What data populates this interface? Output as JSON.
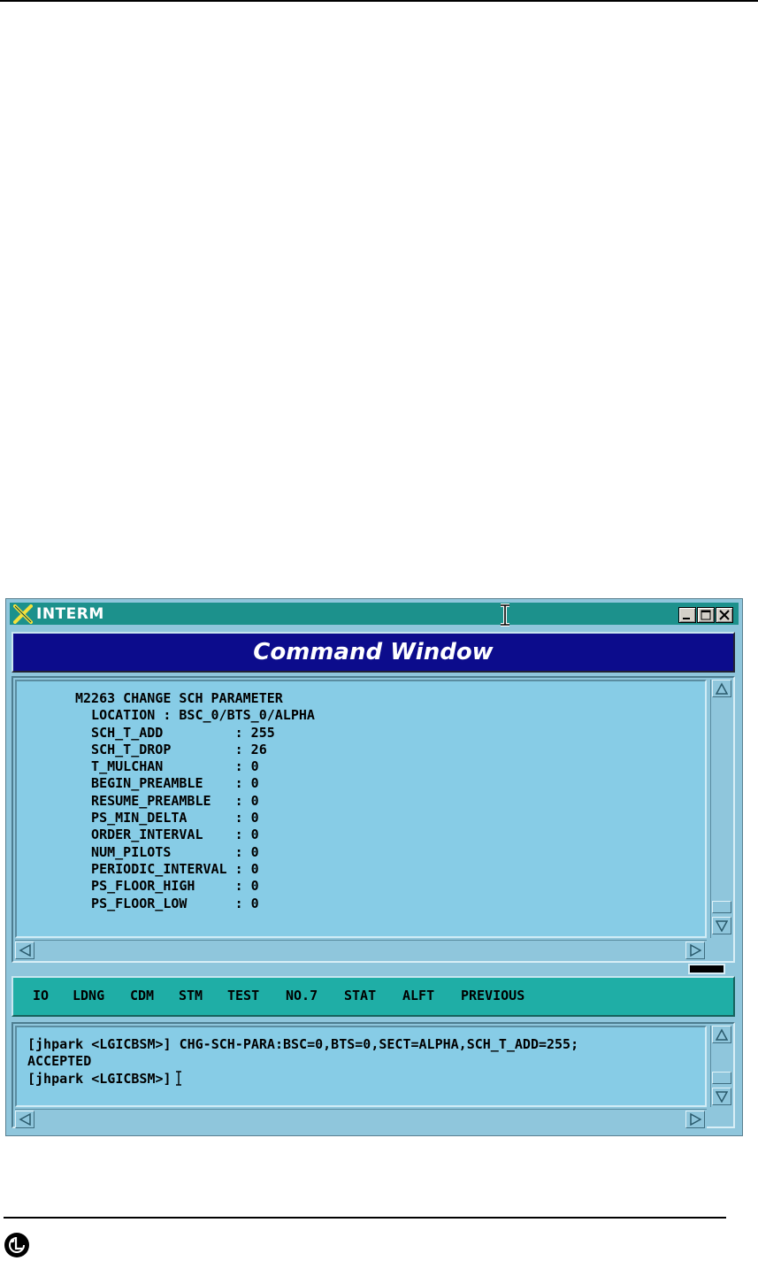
{
  "window": {
    "title": "INTERM",
    "header": "Command Window"
  },
  "output": {
    "lines": [
      "M2263 CHANGE SCH PARAMETER",
      "  LOCATION : BSC_0/BTS_0/ALPHA",
      "  SCH_T_ADD         : 255",
      "  SCH_T_DROP        : 26",
      "  T_MULCHAN         : 0",
      "  BEGIN_PREAMBLE    : 0",
      "  RESUME_PREAMBLE   : 0",
      "  PS_MIN_DELTA      : 0",
      "  ORDER_INTERVAL    : 0",
      "  NUM_PILOTS        : 0",
      "  PERIODIC_INTERVAL : 0",
      "  PS_FLOOR_HIGH     : 0",
      "  PS_FLOOR_LOW      : 0"
    ]
  },
  "menu": {
    "items": [
      "IO",
      "LDNG",
      "CDM",
      "STM",
      "TEST",
      "NO.7",
      "STAT",
      "ALFT",
      "PREVIOUS"
    ]
  },
  "input": {
    "lines": [
      "[jhpark <LGICBSM>] CHG-SCH-PARA:BSC=0,BTS=0,SECT=ALPHA,SCH_T_ADD=255;",
      "ACCEPTED",
      "[jhpark <LGICBSM>]"
    ]
  },
  "icons": {
    "title": "x-logo-icon",
    "cursor": "text-cursor-icon",
    "minimize": "minimize-icon",
    "maximize": "maximize-icon",
    "close": "close-icon",
    "footer": "lg-logo-icon"
  }
}
